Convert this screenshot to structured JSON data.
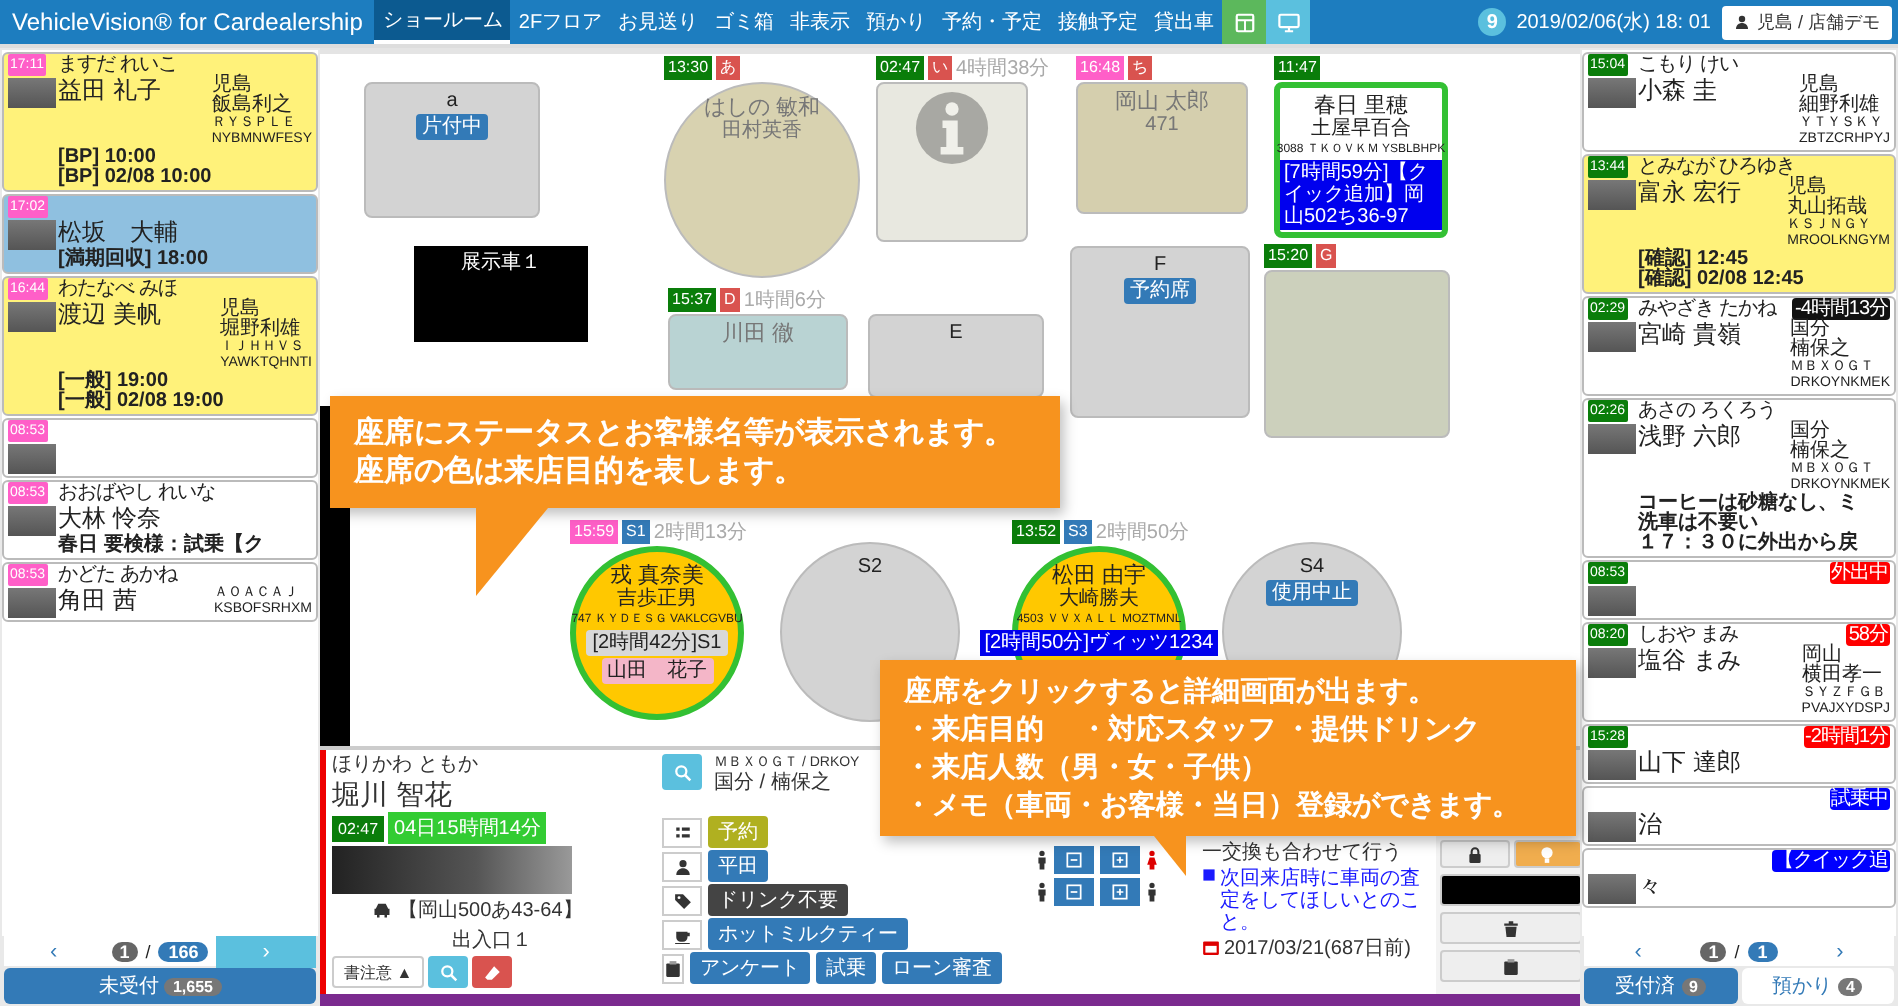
{
  "header": {
    "title": "VehicleVision® for Cardealership",
    "tabs": [
      {
        "label": "ショールーム",
        "selected": true
      },
      {
        "label": "2Fフロア",
        "selected": false
      },
      {
        "label": "お見送り",
        "selected": false
      },
      {
        "label": "ゴミ箱",
        "selected": false
      },
      {
        "label": "非表示",
        "selected": false
      },
      {
        "label": "預かり",
        "selected": false
      },
      {
        "label": "予約・予定",
        "selected": false
      },
      {
        "label": "接触予定",
        "selected": false
      },
      {
        "label": "貸出車",
        "selected": false
      }
    ],
    "notification_count": "9",
    "datetime": "2019/02/06(水) 18: 01",
    "user": "児島 / 店舗デモ"
  },
  "left_queue": {
    "cards": [
      {
        "time": {
          "text": "17:11",
          "color": "#ff5fc8"
        },
        "kana": "ますだ れいこ",
        "name": "益田 礼子",
        "notes": [
          "[BP] 10:00",
          "[BP] 02/08 10:00"
        ],
        "info": [
          "児島",
          "飯島利之",
          "ＲＹＳＰＬＥ",
          "NYBMNWFESY"
        ],
        "color": "#fff27a"
      },
      {
        "time": {
          "text": "17:02",
          "color": "#ff5fc8"
        },
        "name": "松坂　大輔",
        "notes": [
          "[満期回収] 18:00"
        ],
        "color": "#8fc0e0"
      },
      {
        "time": {
          "text": "16:44",
          "color": "#ff5fc8"
        },
        "kana": "わたなべ みほ",
        "name": "渡辺 美帆",
        "notes": [
          "[一般] 19:00",
          "[一般] 02/08 19:00"
        ],
        "info": [
          "児島",
          "堀野利雄",
          "ＩＪＨＨＶＳ",
          "YAWKTQHNTI"
        ],
        "color": "#fff27a"
      },
      {
        "time": {
          "text": "08:53",
          "color": "#ff5fc8"
        },
        "color": "#ffffff"
      },
      {
        "time": {
          "text": "08:53",
          "color": "#ff5fc8"
        },
        "kana": "おおばやし れいな",
        "name": "大林 怜奈",
        "notes": [
          "春日 要検様：試乗【ク"
        ],
        "color": "#ffffff"
      },
      {
        "time": {
          "text": "08:53",
          "color": "#ff5fc8"
        },
        "kana": "かどた あかね",
        "name": "角田 茜",
        "info": [
          "ＡＯＡＣＡＪ",
          "KSBOFSRHXM"
        ],
        "color": "#ffffff"
      }
    ],
    "pager": {
      "prev": "‹",
      "page": "1",
      "separator": "/",
      "total": "166",
      "next": "›",
      "next_disabled": false
    },
    "footer": [
      {
        "label": "未受付",
        "count": "1,655",
        "selected": true
      }
    ]
  },
  "floor": {
    "seats": [
      {
        "kind": "rect",
        "label": "a",
        "color": "#d3d3d3",
        "tags": [
          {
            "text": "片付中",
            "color": "#337ab7"
          }
        ]
      },
      {
        "kind": "circle",
        "color": "#d8d2b0",
        "faded": true,
        "badges": [
          {
            "text": "13:30",
            "color": "#0a7d0a"
          },
          {
            "text": "あ",
            "color": "#d9534f"
          }
        ],
        "lines": [
          "はしの 敏和",
          "田村英香"
        ]
      },
      {
        "kind": "info",
        "color": "#e8e8e0",
        "faded": true,
        "badges": [
          {
            "text": "02:47",
            "color": "#0a7d0a"
          },
          {
            "text": "い",
            "color": "#d9534f"
          }
        ],
        "elapsed": "4時間38分"
      },
      {
        "kind": "rect",
        "color": "#d5cfae",
        "faded": true,
        "badges": [
          {
            "text": "16:48",
            "color": "#ff5fc8"
          },
          {
            "text": "ち",
            "color": "#d9534f"
          }
        ],
        "lines": [
          "岡山 太郎",
          "471"
        ]
      },
      {
        "kind": "rect",
        "highlighted": true,
        "badges": [
          {
            "text": "11:47",
            "color": "#0a7d0a"
          }
        ],
        "lines": [
          "春日 里穂",
          "土屋早百合",
          "3088 ＴＫＯＶＫＭ YSBLBHPK"
        ],
        "bar": "[7時間59分]【クイック追加】岡山502ち36-97"
      },
      {
        "kind": "display",
        "label": "展示車１",
        "color": "#000000"
      },
      {
        "kind": "rect",
        "color": "#b9d3d3",
        "faded": true,
        "badges": [
          {
            "text": "15:37",
            "color": "#0a7d0a"
          },
          {
            "text": "D",
            "color": "#d9534f"
          }
        ],
        "elapsed": "1時間6分",
        "lines": [
          "川田 徹"
        ]
      },
      {
        "kind": "rect",
        "label": "E",
        "color": "#d3d3d3"
      },
      {
        "kind": "rect",
        "label": "F",
        "color": "#d3d3d3",
        "tags": [
          {
            "text": "予約席",
            "color": "#337ab7"
          }
        ]
      },
      {
        "kind": "rect",
        "color": "#ccd0bc",
        "badges": [
          {
            "text": "15:20",
            "color": "#0a7d0a"
          },
          {
            "text": "G",
            "color": "#d9534f"
          }
        ]
      },
      {
        "kind": "circle",
        "color": "#ffc800",
        "highlighted": true,
        "badges": [
          {
            "text": "15:59",
            "color": "#ff5fc8"
          },
          {
            "text": "S1",
            "color": "#337ab7"
          }
        ],
        "elapsed": "2時間13分",
        "lines": [
          "戎 真奈美",
          "吉歩正男",
          "747 ＫＹＤＥＳＧ VAKLCGVBU"
        ],
        "tags": [
          {
            "text": "[2時間42分]S1",
            "color": "#d8d8d8"
          },
          {
            "text": "山田　花子",
            "color": "#f4b6c8"
          }
        ]
      },
      {
        "kind": "circle",
        "label": "S2",
        "color": "#d3d3d3"
      },
      {
        "kind": "circle",
        "color": "#ffc800",
        "highlighted": true,
        "badges": [
          {
            "text": "13:52",
            "color": "#0a7d0a"
          },
          {
            "text": "S3",
            "color": "#337ab7"
          }
        ],
        "elapsed": "2時間50分",
        "lines": [
          "松田 由宇",
          "大崎勝夫",
          "4503 ＶＶＸＡＬＬ MOZTMNL"
        ],
        "bar": "[2時間50分]ヴィッツ1234"
      },
      {
        "kind": "circle",
        "label": "S4",
        "color": "#d3d3d3",
        "tags": [
          {
            "text": "使用中止",
            "color": "#337ab7"
          }
        ]
      }
    ]
  },
  "detail": {
    "kana": "ほりかわ ともか",
    "name": "堀川 智花",
    "vehicle_codes": "ＭＢＸＯＧＴ / DRKOY",
    "staff": "国分 / 楠保之",
    "time": "02:47",
    "elapsed": "04日15時間14分",
    "plate": "【岡山500あ43-64】",
    "entrance": "出入口１",
    "caution": "書注意 ▲",
    "rows": [
      {
        "kind": "list",
        "buttons": [
          {
            "label": "予約",
            "color": "#b0b020"
          }
        ]
      },
      {
        "kind": "person",
        "buttons": [
          {
            "label": "平田",
            "color": "#337ab7"
          }
        ]
      },
      {
        "kind": "tag",
        "buttons": [
          {
            "label": "ドリンク不要",
            "color": "#444444"
          }
        ]
      },
      {
        "kind": "cup",
        "buttons": [
          {
            "label": "ホットミルクティー",
            "color": "#337ab7"
          }
        ]
      },
      {
        "kind": "clipboard",
        "buttons": [
          {
            "label": "アンケート",
            "color": "#337ab7"
          },
          {
            "label": "試乗",
            "color": "#337ab7"
          },
          {
            "label": "ローン審査",
            "color": "#337ab7"
          }
        ]
      }
    ],
    "memo": [
      {
        "text": "一交換も合わせて行う",
        "kind": "plain"
      },
      {
        "text": "次回来店時に車両の査定をしてほしいとのこと。",
        "kind": "link"
      },
      {
        "text": "2017/03/21(687日前)",
        "kind": "date"
      }
    ]
  },
  "right_queue": {
    "cards": [
      {
        "time": {
          "text": "15:04",
          "color": "#0a7d0a"
        },
        "kana": "こもり けい",
        "name": "小森 圭",
        "info": [
          "児島",
          "細野利雄",
          "ＹＴＹＳＫＹ",
          "ZBTZCRHPYJ"
        ],
        "color": "#ffffff"
      },
      {
        "time": {
          "text": "13:44",
          "color": "#0a7d0a"
        },
        "kana": "とみなが ひろゆき",
        "name": "富永 宏行",
        "notes": [
          "[確認] 12:45",
          "[確認] 02/08 12:45"
        ],
        "info": [
          "児島",
          "丸山拓哉",
          "ＫＳＪＮＧＹ",
          "MROOLKNGYM"
        ],
        "color": "#fff27a"
      },
      {
        "time": {
          "text": "02:29",
          "color": "#0a7d0a"
        },
        "kana": "みやざき たかね",
        "name": "宮崎 貴嶺",
        "badge": {
          "text": "-4時間13分",
          "color": "#111111"
        },
        "info": [
          "国分",
          "楠保之",
          "ＭＢＸＯＧＴ",
          "DRKOYNKMEK"
        ],
        "color": "#ffffff"
      },
      {
        "time": {
          "text": "02:26",
          "color": "#0a7d0a"
        },
        "kana": "あさの ろくろう",
        "name": "浅野 六郎",
        "notes": [
          "コーヒーは砂糖なし、ミ",
          "洗車は不要い",
          "１７：３０に外出から戻"
        ],
        "info": [
          "国分",
          "楠保之",
          "ＭＢＸＯＧＴ",
          "DRKOYNKMEK"
        ],
        "color": "#ffffff"
      },
      {
        "time": {
          "text": "08:53",
          "color": "#0a7d0a"
        },
        "badge": {
          "text": "外出中",
          "color": "#ff0000"
        },
        "color": "#ffffff"
      },
      {
        "time": {
          "text": "08:20",
          "color": "#0a7d0a"
        },
        "kana": "しおや まみ",
        "name": "塩谷 まみ",
        "badge": {
          "text": "58分",
          "color": "#ff0000"
        },
        "info": [
          "岡山",
          "横田孝一",
          "ＳＹＺＦＧＢ",
          "PVAJXYDSPJ"
        ],
        "color": "#ffffff"
      },
      {
        "time": {
          "text": "15:28",
          "color": "#0a7d0a"
        },
        "name": "山下 達郎",
        "badge": {
          "text": "-2時間1分",
          "color": "#ff0000"
        },
        "color": "#ffffff"
      },
      {
        "name": "治",
        "badge": {
          "text": "試乗中",
          "color": "#0000ff"
        },
        "color": "#ffffff"
      },
      {
        "name": "々",
        "badge": {
          "text": "【クイック追",
          "color": "#0000ff"
        },
        "color": "#ffffff"
      }
    ],
    "pager": {
      "prev": "‹",
      "page": "1",
      "separator": "/",
      "total": "1",
      "next": "›",
      "next_disabled": true
    },
    "footer": [
      {
        "label": "受付済",
        "count": "9",
        "selected": true
      },
      {
        "label": "預かり",
        "count": "4",
        "selected": false
      }
    ]
  },
  "callouts": [
    {
      "lines": [
        "座席にステータスとお客様名等が表示されます。",
        "座席の色は来店目的を表します。"
      ]
    },
    {
      "lines": [
        "座席をクリックすると詳細画面が出ます。",
        "・来店目的　 ・対応スタッフ ・提供ドリンク",
        "・来店人数（男・女・子供）",
        "・メモ（車両・お客様・当日）登録ができます。"
      ]
    }
  ]
}
